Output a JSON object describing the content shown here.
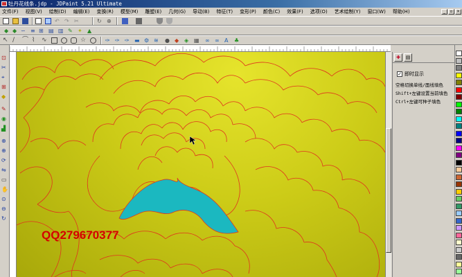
{
  "window": {
    "title": "牡丹花线条.jdp - JDPaint 5.21 Ultimate"
  },
  "menu": {
    "items": [
      {
        "label": "文件(F)"
      },
      {
        "label": "视图(V)"
      },
      {
        "label": "绘制(D)"
      },
      {
        "label": "编辑(E)"
      },
      {
        "label": "变换(R)"
      },
      {
        "label": "模型(M)"
      },
      {
        "label": "雕塑(E)"
      },
      {
        "label": "几何(G)"
      },
      {
        "label": "导动(B)"
      },
      {
        "label": "特征(T)"
      },
      {
        "label": "变形(P)"
      },
      {
        "label": "颜色(C)"
      },
      {
        "label": "效果(F)"
      },
      {
        "label": "选项(O)"
      },
      {
        "label": "艺术绘制(Y)"
      },
      {
        "label": "窗口(W)"
      },
      {
        "label": "帮助(H)"
      }
    ]
  },
  "panel": {
    "checkbox_label": "即时显示",
    "checkbox_checked": true,
    "hints": [
      "空格切换单线/面线填色",
      "Shift+左键设置当前填色",
      "Ctrl+左键可种子填色"
    ]
  },
  "canvas": {
    "watermark": "QQ279670377",
    "background_color": "#cccb17",
    "line_color": "#e0331d",
    "fill_color": "#1bb8c0"
  },
  "palette": {
    "colors": [
      "#ffffff",
      "#c0c0c0",
      "#808080",
      "#ffff00",
      "#808000",
      "#ff0000",
      "#800000",
      "#00ff00",
      "#008000",
      "#00ffff",
      "#008080",
      "#0000ff",
      "#000080",
      "#ff00ff",
      "#800080",
      "#000000",
      "#ffcc99",
      "#cc6633",
      "#993300",
      "#ffcc00",
      "#66cc66",
      "#339966",
      "#99ccff",
      "#3366cc",
      "#cc99ff",
      "#ff6699",
      "#ffffcc",
      "#cccccc",
      "#666666",
      "#ffff99",
      "#99ff99"
    ]
  }
}
